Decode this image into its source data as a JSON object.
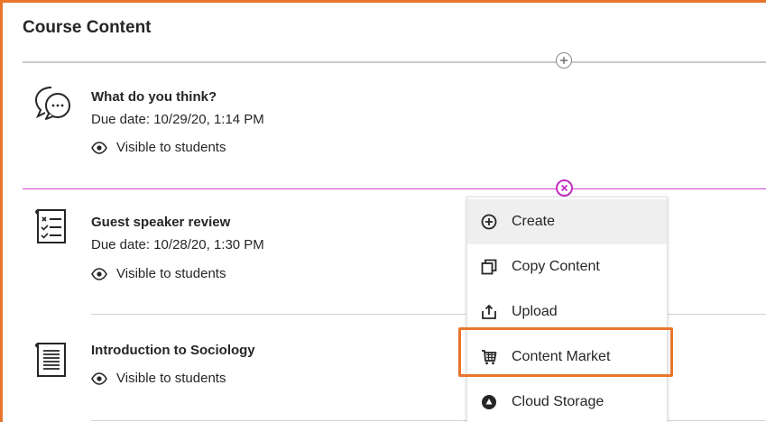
{
  "page": {
    "title": "Course Content"
  },
  "items": [
    {
      "title": "What do you think?",
      "due": "Due date: 10/29/20, 1:14 PM",
      "visibility": "Visible to students",
      "icon": "discussion-icon"
    },
    {
      "title": "Guest speaker review",
      "due": "Due date: 10/28/20, 1:30 PM",
      "visibility": "Visible to students",
      "icon": "test-checklist-icon"
    },
    {
      "title": "Introduction to Sociology",
      "visibility": "Visible to students",
      "icon": "document-icon"
    }
  ],
  "menu": {
    "items": [
      {
        "label": "Create",
        "icon": "plus-circle-icon"
      },
      {
        "label": "Copy Content",
        "icon": "copy-icon"
      },
      {
        "label": "Upload",
        "icon": "upload-icon"
      },
      {
        "label": "Content Market",
        "icon": "cart-icon"
      },
      {
        "label": "Cloud Storage",
        "icon": "cloud-storage-icon"
      }
    ]
  },
  "colors": {
    "highlight": "#e8762b",
    "insert_line": "#d641d6",
    "close_circle": "#c22ec2"
  }
}
